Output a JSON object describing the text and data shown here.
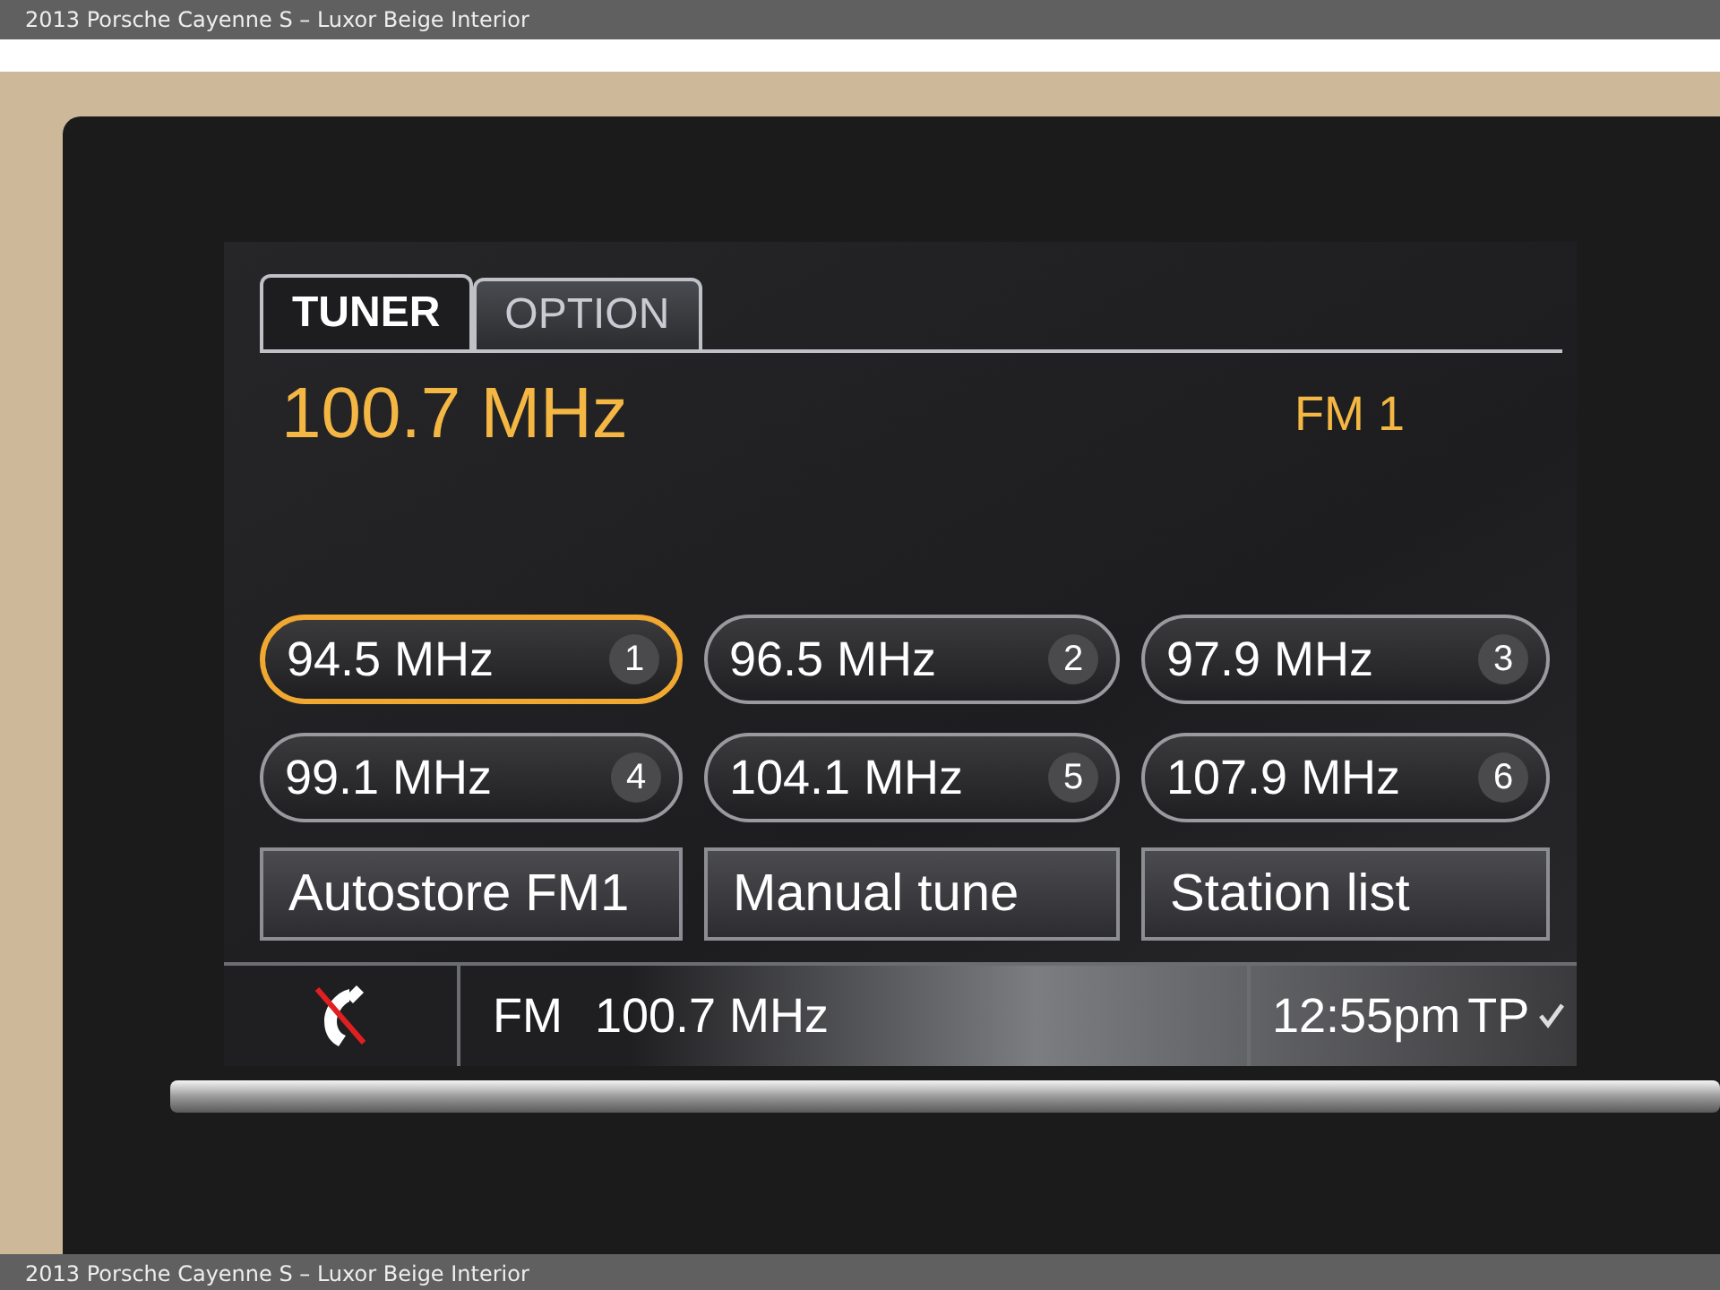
{
  "caption_top": "2013 Porsche Cayenne S – Luxor Beige Interior",
  "tabs": [
    {
      "label": "TUNER",
      "selected": true
    },
    {
      "label": "OPTION",
      "selected": false
    }
  ],
  "frequency": "100.7 MHz",
  "band": "FM 1",
  "presets": [
    {
      "frequency": "94.5 MHz",
      "number": "1",
      "selected": true
    },
    {
      "frequency": "96.5 MHz",
      "number": "2",
      "selected": false
    },
    {
      "frequency": "97.9 MHz",
      "number": "3",
      "selected": false
    },
    {
      "frequency": "99.1 MHz",
      "number": "4",
      "selected": false
    },
    {
      "frequency": "104.1 MHz",
      "number": "5",
      "selected": false
    },
    {
      "frequency": "107.9 MHz",
      "number": "6",
      "selected": false
    }
  ],
  "buttons": [
    "Autostore FM1",
    "Manual tune",
    "Station list"
  ],
  "status_bar": {
    "phone_connected": false,
    "band": "FM",
    "frequency": "100.7 MHz",
    "time": "12:55pm",
    "tp": "TP",
    "tp_active": true
  },
  "caption_bottom": "2013 Porsche Cayenne S – Luxor Beige Interior"
}
